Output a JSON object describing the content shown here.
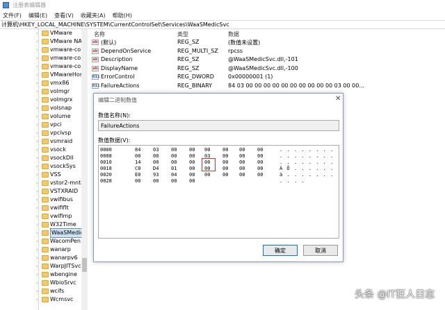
{
  "window": {
    "title": "注册表编辑器"
  },
  "menu": [
    "文件(F)",
    "编辑(E)",
    "查看(V)",
    "收藏夹(A)",
    "帮助(H)"
  ],
  "address": "计算机\\HKEY_LOCAL_MACHINE\\SYSTEM\\CurrentControlSet\\Services\\WaaSMedicSvc",
  "tree": {
    "items": [
      "VMware",
      "VMware NAT",
      "vmware-conv",
      "vmware-conv",
      "vmware-conv",
      "VMwareHost",
      "vmx86",
      "volmgr",
      "volmgrx",
      "volsnap",
      "volume",
      "vpci",
      "vpcivsp",
      "vsmraid",
      "vsock",
      "vsockDll",
      "vsockSys",
      "VSS",
      "vstor2-mntapi",
      "VSTXRAID",
      "vwifibus",
      "vwififlt",
      "vwifimp",
      "W32Time",
      "WaaSMedicS",
      "WacomPen",
      "wanarp",
      "wanarpv6",
      "WarpJITSvc",
      "wbengine",
      "WbioSrvc",
      "wcifs",
      "Wcmsvc"
    ],
    "selected_index": 24
  },
  "values": {
    "headers": {
      "name": "名称",
      "type": "类型",
      "data": "数据"
    },
    "rows": [
      {
        "name": "(默认)",
        "type": "REG_SZ",
        "data": "(数值未设置)",
        "kind": "str"
      },
      {
        "name": "DependOnService",
        "type": "REG_MULTI_SZ",
        "data": "rpcss",
        "kind": "str"
      },
      {
        "name": "Description",
        "type": "REG_SZ",
        "data": "@WaaSMedicSvc.dll,-101",
        "kind": "str"
      },
      {
        "name": "DisplayName",
        "type": "REG_SZ",
        "data": "@WaaSMedicSvc.dll,-100",
        "kind": "str"
      },
      {
        "name": "ErrorControl",
        "type": "REG_DWORD",
        "data": "0x00000001 (1)",
        "kind": "bin"
      },
      {
        "name": "FailureActions",
        "type": "REG_BINARY",
        "data": "84 03 00 00 00 00 00 00 00 00 00 00 03 00 00...",
        "kind": "bin"
      }
    ]
  },
  "dialog": {
    "title": "编辑二进制数值",
    "name_label": "数值名称(N):",
    "name_value": "FailureActions",
    "data_label": "数值数据(V):",
    "ok_label": "确定",
    "cancel_label": "取消",
    "hex_rows": [
      {
        "offset": "0000",
        "bytes": [
          "84",
          "03",
          "00",
          "00",
          "00",
          "00",
          "00",
          "00"
        ],
        "ascii": ". . . . . . . ."
      },
      {
        "offset": "0008",
        "bytes": [
          "00",
          "00",
          "00",
          "00",
          "03",
          "00",
          "00",
          "00"
        ],
        "ascii": ". . . . . . . ."
      },
      {
        "offset": "0010",
        "bytes": [
          "14",
          "00",
          "00",
          "00",
          "00",
          "00",
          "00",
          "00"
        ],
        "ascii": ". . . . . . . ."
      },
      {
        "offset": "0018",
        "bytes": [
          "C0",
          "D4",
          "01",
          "00",
          "00",
          "00",
          "00",
          "00"
        ],
        "ascii": "À Ô . . . . . ."
      },
      {
        "offset": "0020",
        "bytes": [
          "E0",
          "93",
          "04",
          "00",
          "00",
          "00",
          "00",
          "00"
        ],
        "ascii": "à . . . . . . ."
      },
      {
        "offset": "0028",
        "bytes": [
          "00",
          "00",
          "00",
          "00"
        ],
        "ascii": ". . . ."
      }
    ]
  },
  "watermark": "头条 @IT狂人日志"
}
